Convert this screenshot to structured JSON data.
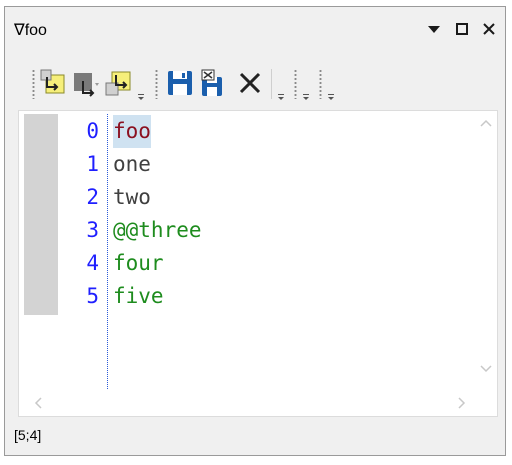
{
  "window": {
    "title": "∇foo",
    "dropdown_icon": "triangle-down-icon",
    "maximize_icon": "square-icon",
    "close_icon": "x-icon"
  },
  "toolbar": {
    "buttons": [
      {
        "icon": "insert-line-yellow-icon"
      },
      {
        "icon": "insert-line-gray-icon"
      },
      {
        "icon": "insert-line-yellow-2-icon"
      },
      {
        "icon": "save-icon"
      },
      {
        "icon": "save-and-close-icon"
      },
      {
        "icon": "delete-x-icon"
      }
    ],
    "colors": {
      "accent_yellow": "#f6ef7a",
      "save_blue": "#1b5fad"
    }
  },
  "editor": {
    "lines": [
      {
        "number": "0",
        "text": "foo",
        "color": "#8b1020",
        "selected": true
      },
      {
        "number": "1",
        "text": "one",
        "color": "#404040"
      },
      {
        "number": "2",
        "text": "two",
        "color": "#404040"
      },
      {
        "number": "3",
        "text": "@@three",
        "color": "#1e8c1e"
      },
      {
        "number": "4",
        "text": "four",
        "color": "#1e8c1e"
      },
      {
        "number": "5",
        "text": "five",
        "color": "#1e8c1e"
      }
    ],
    "line_number_color": "#1f1fff"
  },
  "status": {
    "cursor": "[5;4]"
  }
}
